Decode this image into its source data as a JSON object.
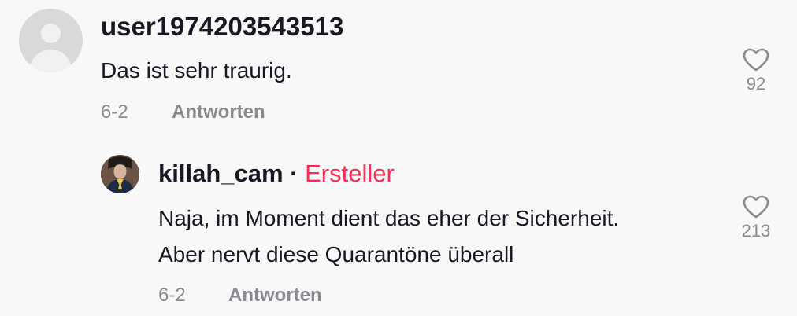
{
  "comments": [
    {
      "username": "user1974203543513",
      "text": "Das ist sehr traurig.",
      "date": "6-2",
      "reply_label": "Antworten",
      "likes": "92"
    }
  ],
  "replies": [
    {
      "username": "killah_cam",
      "separator": "·",
      "badge": "Ersteller",
      "text_lines": [
        "Naja, im Moment dient das eher der Sicherheit.",
        "Aber nervt diese Quarantöne überall"
      ],
      "date": "6-2",
      "reply_label": "Antworten",
      "likes": "213"
    }
  ],
  "colors": {
    "creator_badge": "#fe2c55",
    "meta_gray": "#8a8b91",
    "text": "#161823"
  },
  "icons": {
    "avatar_default": "user-silhouette-icon",
    "like": "heart-outline-icon"
  }
}
